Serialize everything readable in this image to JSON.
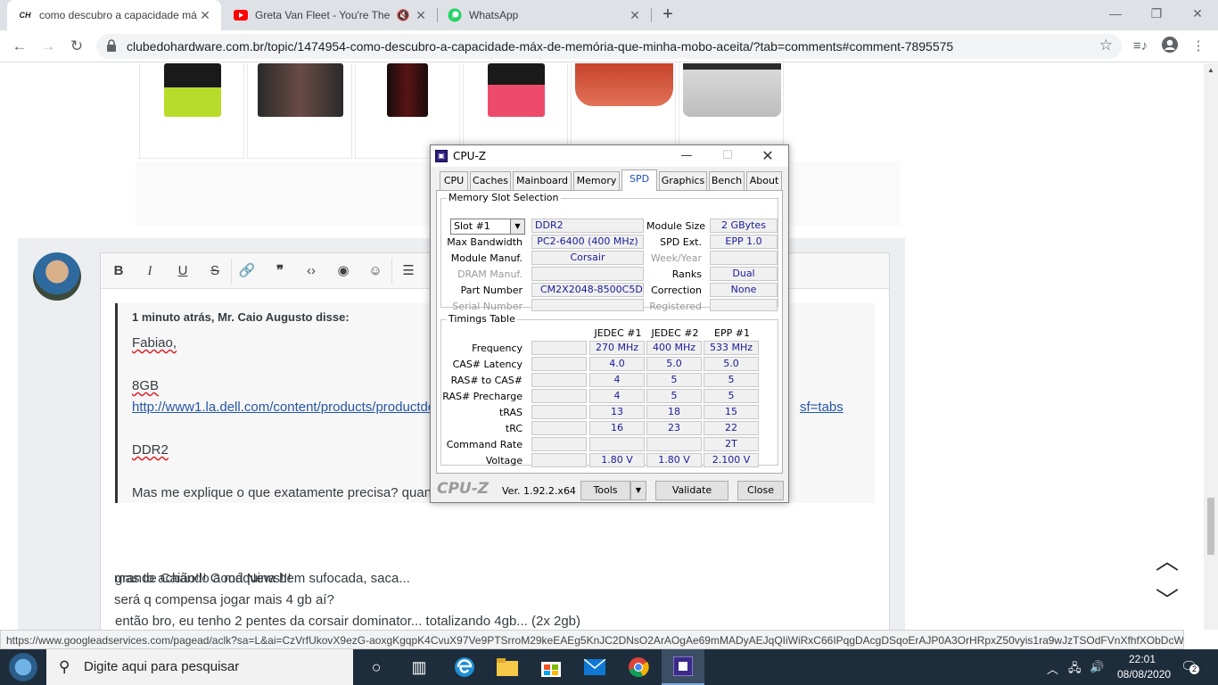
{
  "browser": {
    "tabs": [
      {
        "title": "como descubro a capacidade má",
        "favicon": "clube-do-hardware-logo",
        "favicon_text": "CH",
        "active": true
      },
      {
        "title": "Greta Van Fleet - You're The",
        "favicon": "youtube-icon",
        "muted": true
      },
      {
        "title": "WhatsApp",
        "favicon": "whatsapp-icon"
      }
    ],
    "url": "clubedohardware.com.br/topic/1474954-como-descubro-a-capacidade-máx-de-memória-que-minha-mobo-aceita/?tab=comments#comment-7895575",
    "status_url": "https://www.googleadservices.com/pagead/aclk?sa=L&ai=CzVrfUkovX9ezG-aoxgKgqpK4CvuX97Ve9PTSrroM29keEAEg5KnJC2DNsO2ArAOgAe69mMADyAEJqQIiWiRxC66IPqgDAcgDSqoErAJP0A3OrHRpxZ50vyis1ra9wJzTSOdFVnXfhfXObDcWiq0Rms..."
  },
  "editor": {
    "quote_header": "1 minuto atrás, Mr. Caio Augusto disse:",
    "quote_lines": [
      {
        "text": "Fabiao,",
        "style": "spell"
      },
      {
        "text": "8GB",
        "style": "spell"
      },
      {
        "text": "http://www1.la.dell.com/content/products/productde",
        "style": "link"
      },
      {
        "text": "sf=tabs",
        "style": "link"
      },
      {
        "text": "DDR2",
        "style": "spell"
      },
      {
        "text": "Mas me explique o que exatamente precisa? quan",
        "style": "plain"
      }
    ],
    "body_lines": [
      "grande Caião!!! Good News!!!",
      "então bro, eu tenho 2 pentes da corsair dominator... totalizando 4gb... (2x 2gb)",
      "mas to achando a máquina bem sufocada, saca...",
      "será q compensa jogar mais 4 gb aí?"
    ]
  },
  "cpuz": {
    "title": "CPU-Z",
    "tabs": [
      "CPU",
      "Caches",
      "Mainboard",
      "Memory",
      "SPD",
      "Graphics",
      "Bench",
      "About"
    ],
    "active_tab": "SPD",
    "slot_group_title": "Memory Slot Selection",
    "slot": "Slot #1",
    "memory_type": "DDR2",
    "module_size_label": "Module Size",
    "module_size": "2 GBytes",
    "max_bandwidth_label": "Max Bandwidth",
    "max_bandwidth": "PC2-6400 (400 MHz)",
    "spd_ext_label": "SPD Ext.",
    "spd_ext": "EPP 1.0",
    "manuf_label": "Module Manuf.",
    "manuf": "Corsair",
    "weekyear_label": "Week/Year",
    "dram_label": "DRAM Manuf.",
    "ranks_label": "Ranks",
    "ranks": "Dual",
    "part_label": "Part Number",
    "part": "CM2X2048-8500C5D",
    "correction_label": "Correction",
    "correction": "None",
    "serial_label": "Serial Number",
    "registered_label": "Registered",
    "timings_title": "Timings Table",
    "timing_columns": [
      "JEDEC #1",
      "JEDEC #2",
      "EPP #1"
    ],
    "timing_rows": [
      {
        "label": "Frequency",
        "values": [
          "270 MHz",
          "400 MHz",
          "533 MHz"
        ]
      },
      {
        "label": "CAS# Latency",
        "values": [
          "4.0",
          "5.0",
          "5.0"
        ]
      },
      {
        "label": "RAS# to CAS#",
        "values": [
          "4",
          "5",
          "5"
        ]
      },
      {
        "label": "RAS# Precharge",
        "values": [
          "4",
          "5",
          "5"
        ]
      },
      {
        "label": "tRAS",
        "values": [
          "13",
          "18",
          "15"
        ]
      },
      {
        "label": "tRC",
        "values": [
          "16",
          "23",
          "22"
        ]
      },
      {
        "label": "Command Rate",
        "values": [
          "",
          "",
          "2T"
        ]
      },
      {
        "label": "Voltage",
        "values": [
          "1.80 V",
          "1.80 V",
          "2.100 V"
        ]
      }
    ],
    "brand": "CPU-Z",
    "version": "Ver. 1.92.2.x64",
    "tools_label": "Tools",
    "validate_label": "Validate",
    "close_label": "Close"
  },
  "taskbar": {
    "search_placeholder": "Digite aqui para pesquisar",
    "time": "22:01",
    "date": "08/08/2020",
    "notification_count": "2"
  }
}
